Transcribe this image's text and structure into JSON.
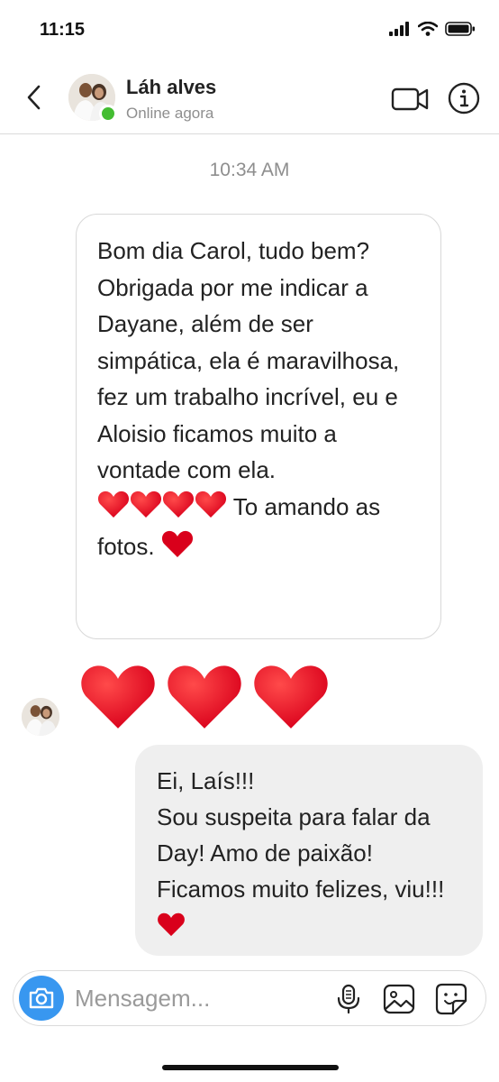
{
  "status_bar": {
    "time": "11:15"
  },
  "header": {
    "back_icon": "chevron-left-icon",
    "contact_name": "Láh alves",
    "contact_status": "Online agora",
    "video_icon": "video-camera-icon",
    "info_icon": "info-icon",
    "online_color": "#44bd32"
  },
  "conversation": {
    "timestamp": "10:34 AM",
    "incoming_message": {
      "text": "Bom dia Carol, tudo bem?\nObrigada por me indicar a Dayane, além de ser simpática, ela é maravilhosa, fez um trabalho incrível, eu e Aloisio ficamos muito a vontade  com ela.",
      "hearts_text": "To amando as fotos.",
      "heart_count": 4
    },
    "heart_reaction_count": 3,
    "outgoing_message": {
      "text": "Ei, Laís!!!\nSou suspeita para falar da Day! Amo de paixão! Ficamos muito felizes, viu!!!"
    }
  },
  "composer": {
    "placeholder": "Mensagem...",
    "camera_icon": "camera-icon",
    "mic_icon": "microphone-icon",
    "gallery_icon": "image-icon",
    "sticker_icon": "sticker-icon",
    "accent_color": "#3897f0"
  },
  "colors": {
    "heart": "#d9001b",
    "bubble_outgoing": "#efefef",
    "bubble_border": "#d8d8d8"
  }
}
